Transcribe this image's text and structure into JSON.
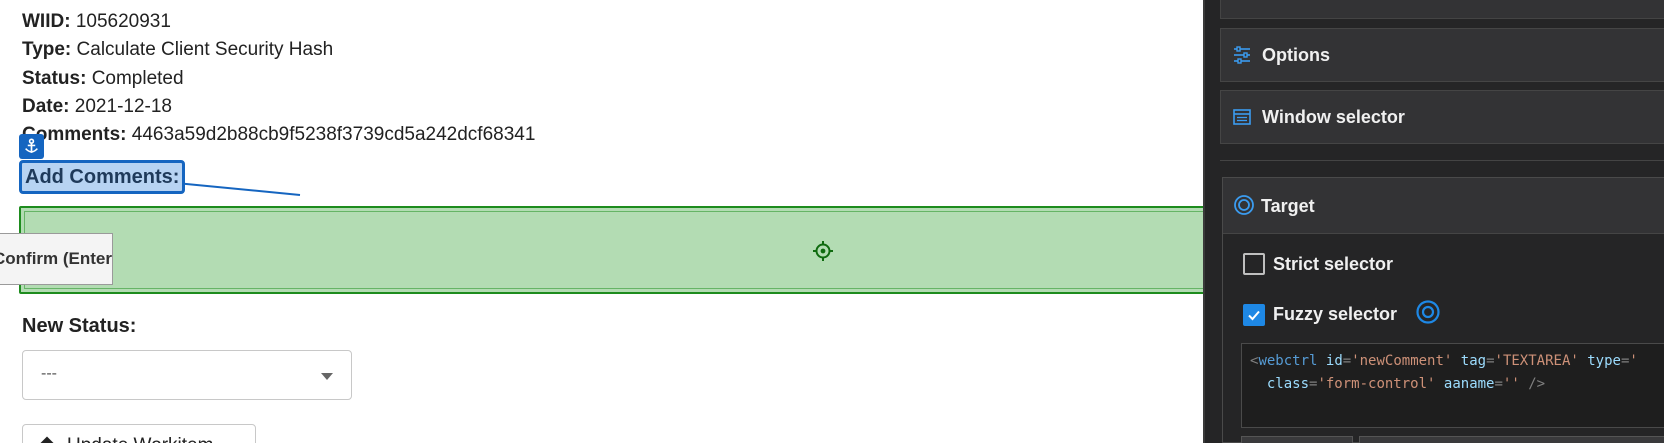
{
  "info": {
    "wiid_label": "WIID:",
    "wiid_value": "105620931",
    "type_label": "Type:",
    "type_value": "Calculate Client Security Hash",
    "status_label": "Status:",
    "status_value": "Completed",
    "date_label": "Date:",
    "date_value": "2021-12-18",
    "comments_label": "Comments:",
    "comments_value": "4463a59d2b88cb9f5238f3739cd5a242dcf68341"
  },
  "add_comments_label": "Add Comments:",
  "confirm_tooltip": "Confirm (Enter)",
  "new_status": {
    "label": "New Status:",
    "selected": "---"
  },
  "update_button_label": "Update Workitem",
  "panel": {
    "options_label": "Options",
    "window_selector_label": "Window selector",
    "target_label": "Target",
    "strict_selector_label": "Strict selector",
    "strict_selector_checked": false,
    "fuzzy_selector_label": "Fuzzy selector",
    "fuzzy_selector_checked": true,
    "selector_code": {
      "tag": "webctrl",
      "id_attr": "id",
      "id_val": "'newComment'",
      "tag_attr": "tag",
      "tag_val": "'TEXTAREA'",
      "type_attr": "type",
      "type_val": "'",
      "class_attr": "class",
      "class_val": "'form-control'",
      "aaname_attr": "aaname",
      "aaname_val": "''"
    }
  },
  "colors": {
    "accent": "#1e88e5",
    "selection_blue": "#1565c0",
    "target_green": "#1e8c1e",
    "target_fill": "#b3dcb3",
    "panel_bg": "#252526"
  }
}
